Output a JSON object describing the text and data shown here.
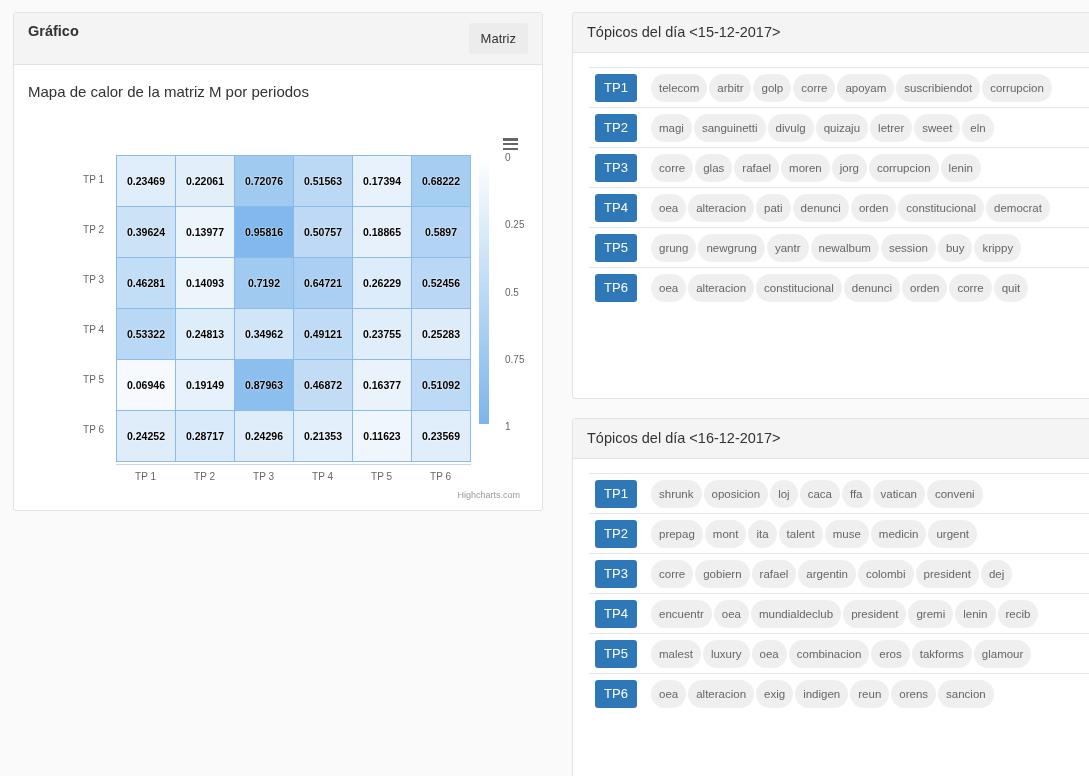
{
  "chart_panel": {
    "title": "Gráfico",
    "button": "Matriz",
    "subtitle": "Mapa de calor de la matriz M por periodos",
    "heatmap": {
      "y_categories": [
        "TP 1",
        "TP 2",
        "TP 3",
        "TP 4",
        "TP 5",
        "TP 6"
      ],
      "x_categories": [
        "TP 1",
        "TP 2",
        "TP 3",
        "TP 4",
        "TP 5",
        "TP 6"
      ],
      "rows": [
        [
          "0.23469",
          "0.22061",
          "0.72076",
          "0.51563",
          "0.17394",
          "0.68222"
        ],
        [
          "0.39624",
          "0.13977",
          "0.95816",
          "0.50757",
          "0.18865",
          "0.5897"
        ],
        [
          "0.46281",
          "0.14093",
          "0.7192",
          "0.64721",
          "0.26229",
          "0.52456"
        ],
        [
          "0.53322",
          "0.24813",
          "0.34962",
          "0.49121",
          "0.23755",
          "0.25283"
        ],
        [
          "0.06946",
          "0.19149",
          "0.87963",
          "0.46872",
          "0.16377",
          "0.51092"
        ],
        [
          "0.24252",
          "0.28717",
          "0.24296",
          "0.21353",
          "0.11623",
          "0.23569"
        ]
      ],
      "color_axis": [
        "0",
        "0.25",
        "0.5",
        "0.75",
        "1"
      ],
      "credits": "Highcharts.com"
    }
  },
  "topic_panels": [
    {
      "title": "Tópicos del día <15-12-2017>",
      "topics": [
        {
          "label": "TP1",
          "words": [
            "telecom",
            "arbitr",
            "golp",
            "corre",
            "apoyam",
            "suscribiendot",
            "corrupcion"
          ]
        },
        {
          "label": "TP2",
          "words": [
            "magi",
            "sanguinetti",
            "divulg",
            "quizaju",
            "letrer",
            "sweet",
            "eln"
          ]
        },
        {
          "label": "TP3",
          "words": [
            "corre",
            "glas",
            "rafael",
            "moren",
            "jorg",
            "corrupcion",
            "lenin"
          ]
        },
        {
          "label": "TP4",
          "words": [
            "oea",
            "alteracion",
            "pati",
            "denunci",
            "orden",
            "constitucional",
            "democrat"
          ]
        },
        {
          "label": "TP5",
          "words": [
            "grung",
            "newgrung",
            "yantr",
            "newalbum",
            "session",
            "buy",
            "krippy"
          ]
        },
        {
          "label": "TP6",
          "words": [
            "oea",
            "alteracion",
            "constitucional",
            "denunci",
            "orden",
            "corre",
            "quit"
          ]
        }
      ]
    },
    {
      "title": "Tópicos del día <16-12-2017>",
      "topics": [
        {
          "label": "TP1",
          "words": [
            "shrunk",
            "oposicion",
            "loj",
            "caca",
            "ffa",
            "vatican",
            "conveni"
          ]
        },
        {
          "label": "TP2",
          "words": [
            "prepag",
            "mont",
            "ita",
            "talent",
            "muse",
            "medicin",
            "urgent"
          ]
        },
        {
          "label": "TP3",
          "words": [
            "corre",
            "gobiern",
            "rafael",
            "argentin",
            "colombi",
            "president",
            "dej"
          ]
        },
        {
          "label": "TP4",
          "words": [
            "encuentr",
            "oea",
            "mundialdeclub",
            "president",
            "gremi",
            "lenin",
            "recib"
          ]
        },
        {
          "label": "TP5",
          "words": [
            "malest",
            "luxury",
            "oea",
            "combinacion",
            "eros",
            "takforms",
            "glamour"
          ]
        },
        {
          "label": "TP6",
          "words": [
            "oea",
            "alteracion",
            "exig",
            "indigen",
            "reun",
            "orens",
            "sancion"
          ]
        }
      ]
    }
  ]
}
